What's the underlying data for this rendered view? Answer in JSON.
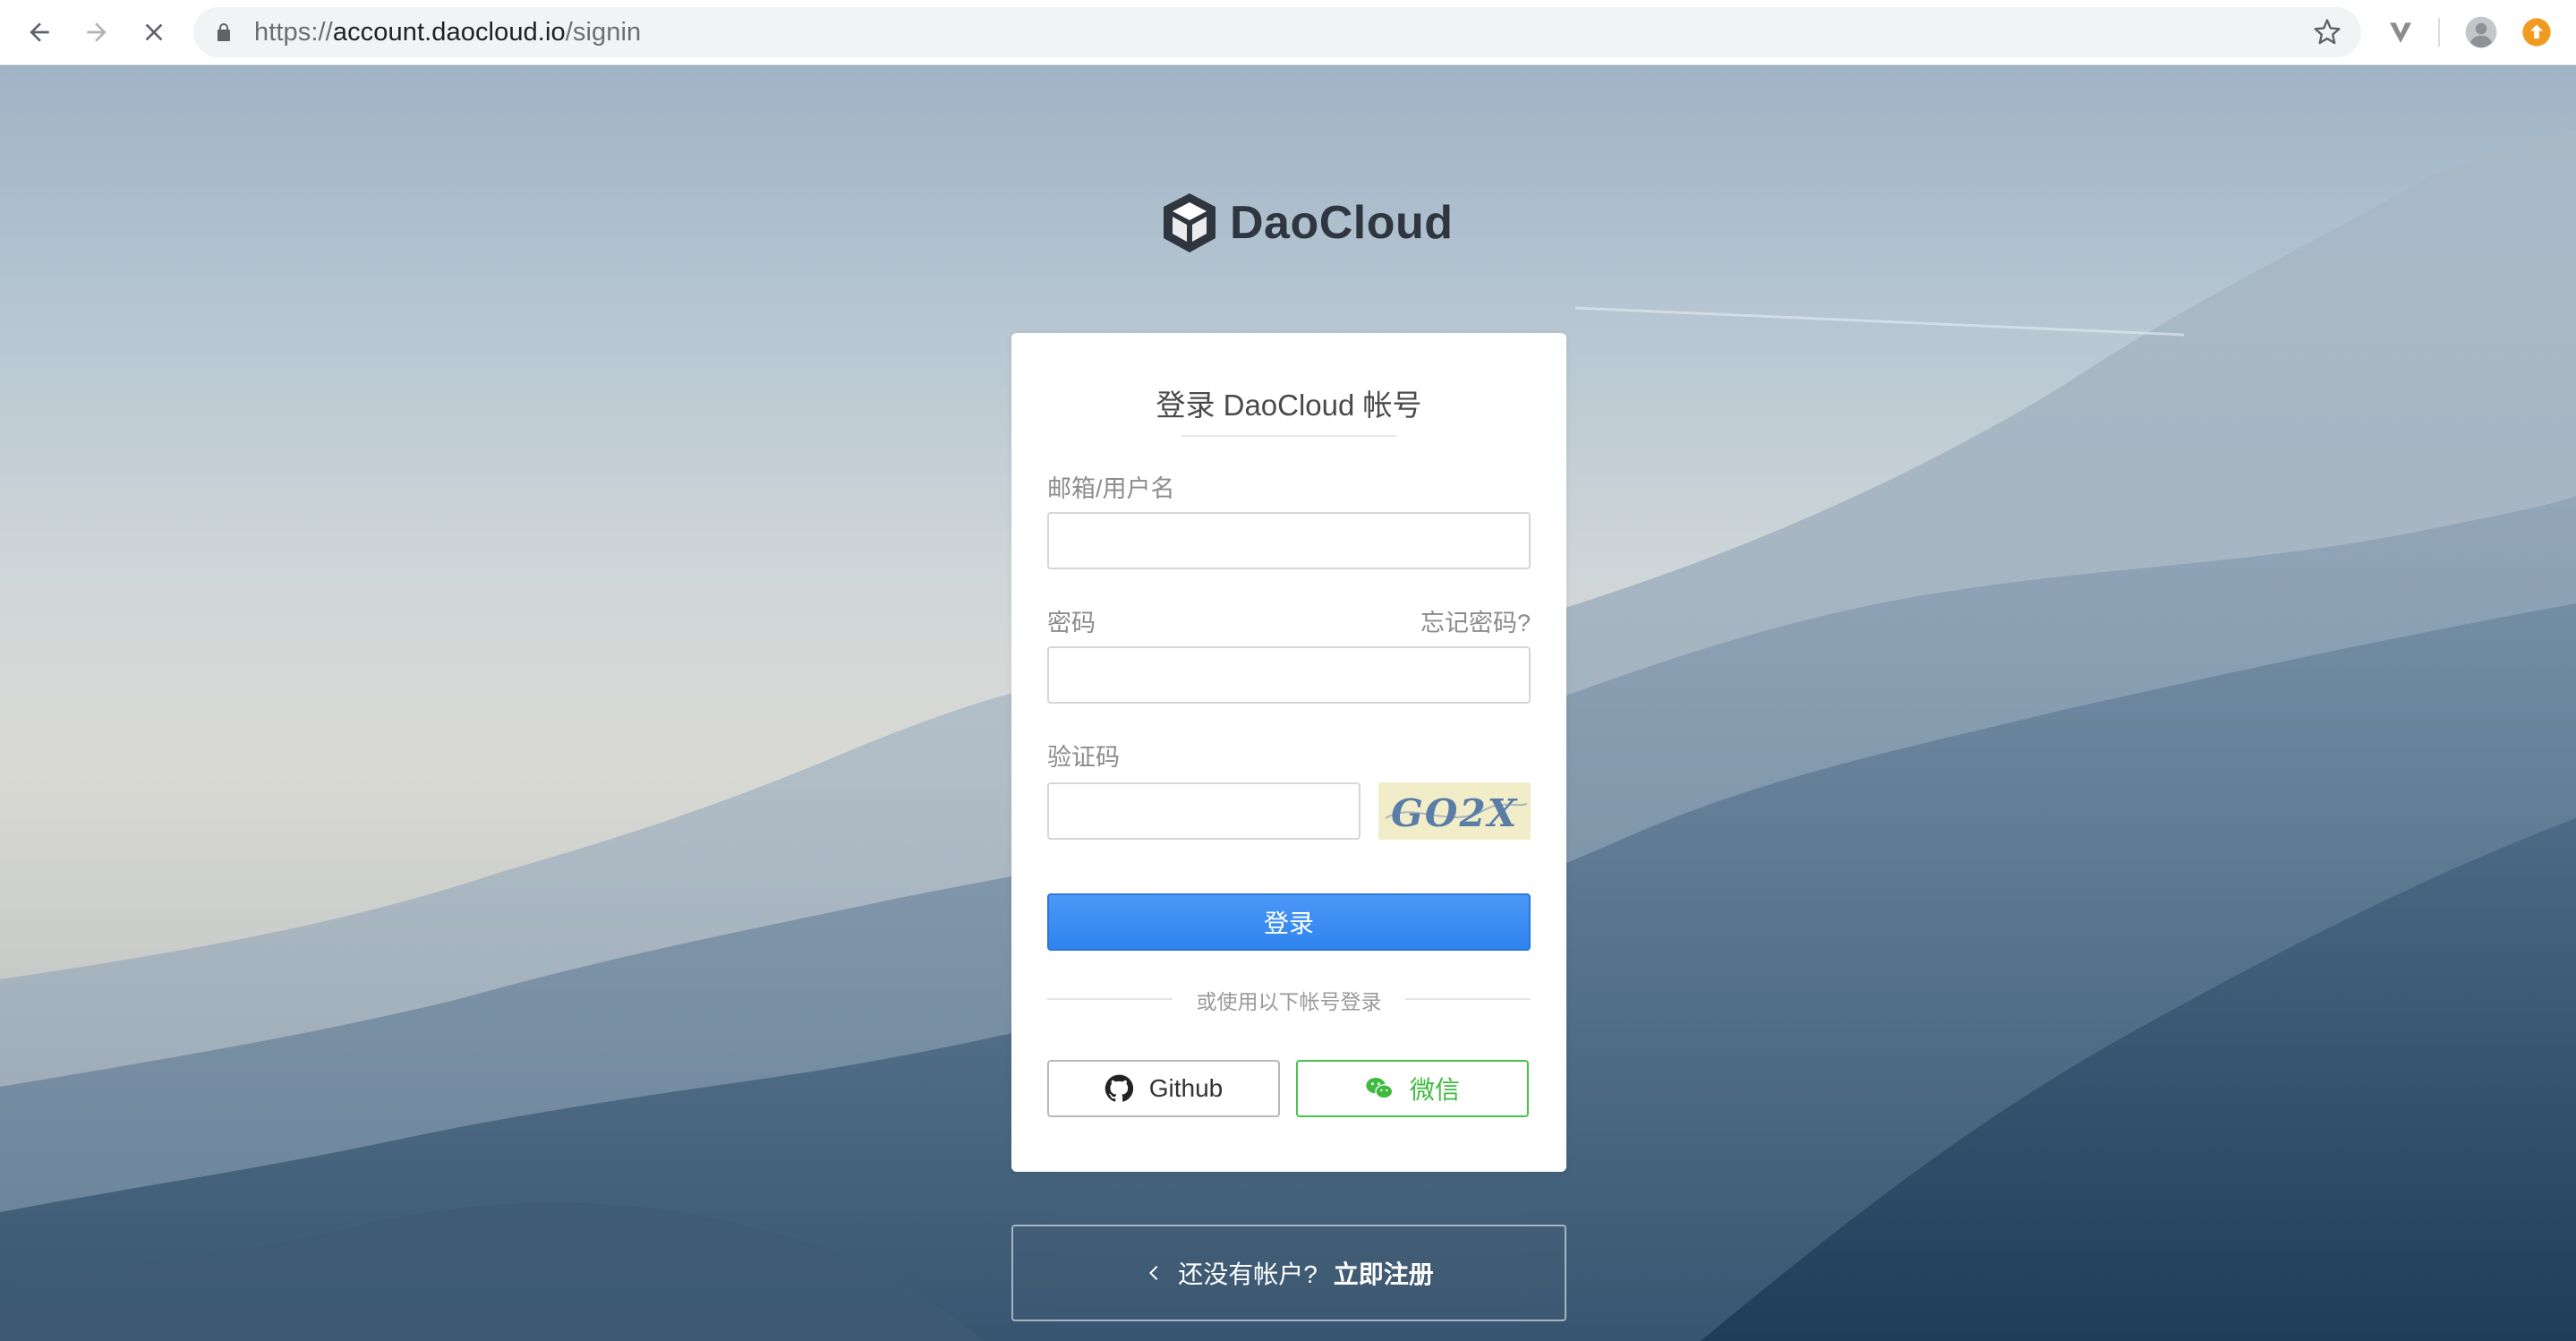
{
  "browser": {
    "url_scheme": "https://",
    "url_host": "account.daocloud.io",
    "url_path": "/signin"
  },
  "logo": {
    "text": "DaoCloud"
  },
  "card": {
    "title": "登录 DaoCloud 帐号",
    "email_label": "邮箱/用户名",
    "email_value": "",
    "password_label": "密码",
    "password_value": "",
    "forgot_label": "忘记密码?",
    "captcha_label": "验证码",
    "captcha_value": "",
    "captcha_image_text": "GO2X",
    "login_label": "登录",
    "or_text": "或使用以下帐号登录",
    "github_label": "Github",
    "wechat_label": "微信"
  },
  "register": {
    "prompt": "还没有帐户?",
    "link": "立即注册"
  },
  "colors": {
    "primary": "#3a8ef3",
    "wechat": "#3fba3f",
    "logo": "#2f3640"
  }
}
